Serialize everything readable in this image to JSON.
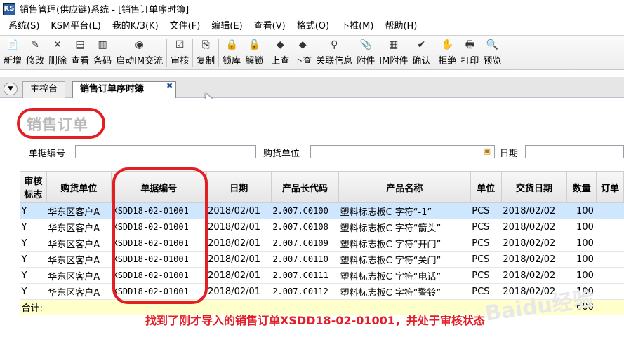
{
  "window": {
    "title": "销售管理(供应链)系统 - [销售订单序时簿]",
    "icon_text": "KS"
  },
  "menu": [
    "系统(S)",
    "KSM平台(L)",
    "我的K/3(K)",
    "文件(F)",
    "编辑(E)",
    "查看(V)",
    "格式(O)",
    "下推(M)",
    "帮助(H)"
  ],
  "toolbar": {
    "groups": [
      [
        {
          "label": "新增",
          "icon": "📄"
        },
        {
          "label": "修改",
          "icon": "✎"
        },
        {
          "label": "删除",
          "icon": "✕"
        },
        {
          "label": "查看",
          "icon": "▤"
        },
        {
          "label": "条码",
          "icon": "▥"
        },
        {
          "label": "启动IM交流",
          "icon": "◉"
        }
      ],
      [
        {
          "label": "审核",
          "icon": "☑"
        }
      ],
      [
        {
          "label": "复制",
          "icon": "⎘"
        }
      ],
      [
        {
          "label": "锁库",
          "icon": "🔒"
        },
        {
          "label": "解锁",
          "icon": "🔓"
        }
      ],
      [
        {
          "label": "上查",
          "icon": "◆"
        },
        {
          "label": "下查",
          "icon": "◆"
        },
        {
          "label": "关联信息",
          "icon": "⚲"
        },
        {
          "label": "附件",
          "icon": "📎"
        },
        {
          "label": "IM附件",
          "icon": "▦"
        },
        {
          "label": "确认",
          "icon": "✔"
        }
      ],
      [
        {
          "label": "拒绝",
          "icon": "✋"
        },
        {
          "label": "打印",
          "icon": "🖶"
        },
        {
          "label": "预览",
          "icon": "🔍"
        }
      ]
    ]
  },
  "tabs": {
    "home": "主控台",
    "active": "销售订单序时簿",
    "close": "✖"
  },
  "form": {
    "title": "销售订单"
  },
  "filters": {
    "bill_no_label": "单据编号",
    "customer_label": "购货单位",
    "date_label": "日期"
  },
  "grid": {
    "headers": [
      "审核标志",
      "购货单位",
      "单据编号",
      "日期",
      "产品长代码",
      "产品名称",
      "单位",
      "交货日期",
      "数量",
      "订单"
    ],
    "rows": [
      [
        "Y",
        "华东区客户A",
        "XSDD18-02-01001",
        "2018/02/01",
        "2.007.C0100",
        "塑料标志板C 字符“-1”",
        "PCS",
        "2018/02/02",
        "100",
        ""
      ],
      [
        "Y",
        "华东区客户A",
        "XSDD18-02-01001",
        "2018/02/01",
        "2.007.C0108",
        "塑料标志板C 字符“箭头”",
        "PCS",
        "2018/02/02",
        "100",
        ""
      ],
      [
        "Y",
        "华东区客户A",
        "XSDD18-02-01001",
        "2018/02/01",
        "2.007.C0109",
        "塑料标志板C 字符“开门”",
        "PCS",
        "2018/02/02",
        "100",
        ""
      ],
      [
        "Y",
        "华东区客户A",
        "XSDD18-02-01001",
        "2018/02/01",
        "2.007.C0110",
        "塑料标志板C 字符“关门”",
        "PCS",
        "2018/02/02",
        "100",
        ""
      ],
      [
        "Y",
        "华东区客户A",
        "XSDD18-02-01001",
        "2018/02/01",
        "2.007.C0111",
        "塑料标志板C 字符“电话”",
        "PCS",
        "2018/02/02",
        "100",
        ""
      ],
      [
        "Y",
        "华东区客户A",
        "XSDD18-02-01001",
        "2018/02/01",
        "2.007.C0112",
        "塑料标志板C 字符“警铃”",
        "PCS",
        "2018/02/02",
        "100",
        ""
      ]
    ],
    "total_label": "合计:",
    "total_qty": "600"
  },
  "annotation": "找到了刚才导入的销售订单XSDD18-02-01001，并处于审核状态",
  "watermark": "Baidu经验",
  "colors": {
    "highlight": "#e31e24",
    "selected_row": "#cfe6ff",
    "total_row": "#ffffcc"
  }
}
